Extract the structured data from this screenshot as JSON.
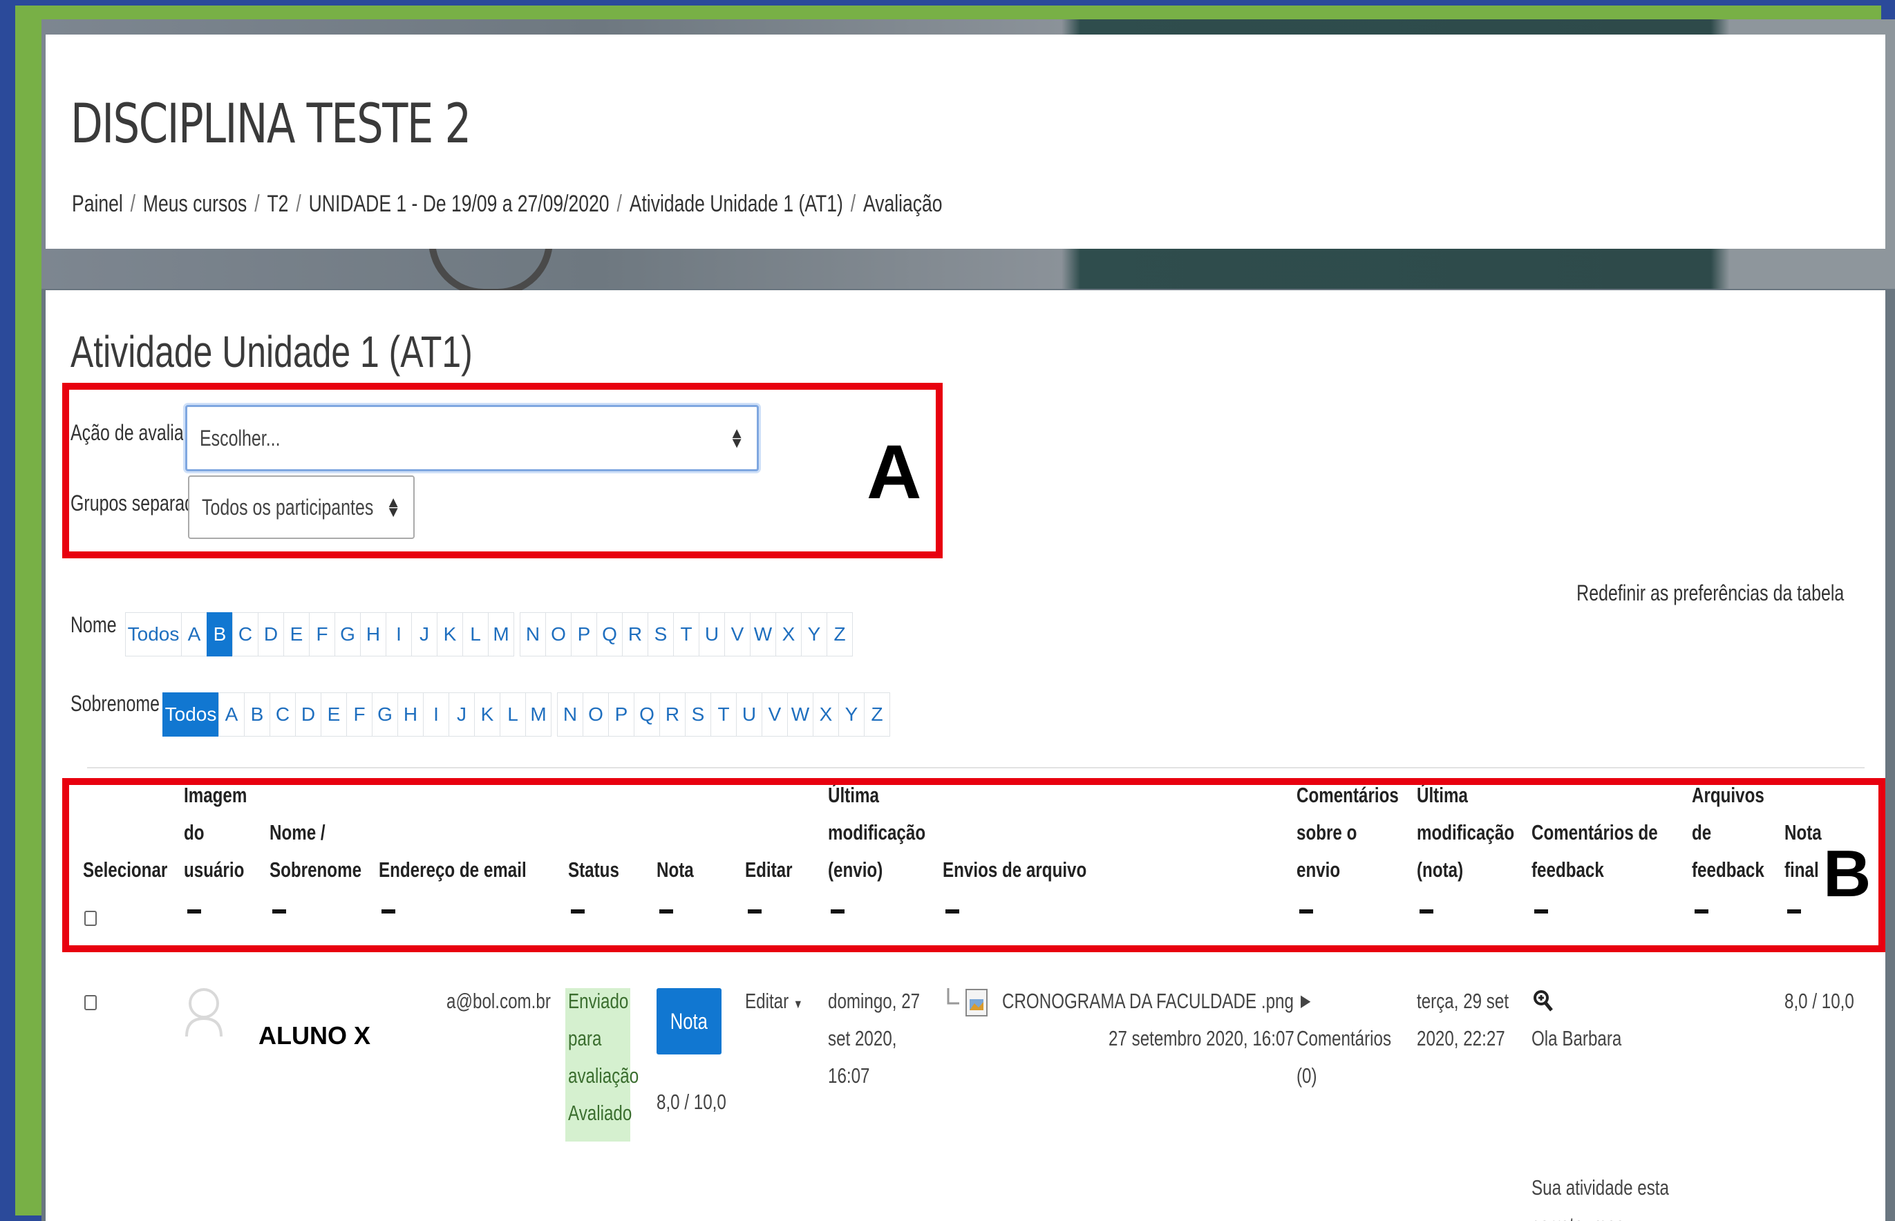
{
  "course": {
    "title": "DISCIPLINA TESTE 2",
    "breadcrumb": [
      "Painel",
      "Meus cursos",
      "T2",
      "UNIDADE 1 - De 19/09 a 27/09/2020",
      "Atividade Unidade 1 (AT1)",
      "Avaliação"
    ]
  },
  "activity": {
    "title": "Atividade Unidade 1 (AT1)",
    "grading_action_label": "Ação de avaliação",
    "grading_action_value": "Escolher...",
    "groups_label": "Grupos separados",
    "groups_value": "Todos os participantes"
  },
  "annotations": {
    "box_a": "A",
    "box_b": "B"
  },
  "reset_prefs": "Redefinir as preferências da tabela",
  "filters": {
    "first_name_label": "Nome",
    "last_name_label": "Sobrenome",
    "all_label": "Todos",
    "letters": [
      "A",
      "B",
      "C",
      "D",
      "E",
      "F",
      "G",
      "H",
      "I",
      "J",
      "K",
      "L",
      "M",
      "N",
      "O",
      "P",
      "Q",
      "R",
      "S",
      "T",
      "U",
      "V",
      "W",
      "X",
      "Y",
      "Z"
    ],
    "first_name_selected": "B",
    "last_name_selected": "Todos"
  },
  "table": {
    "headers": {
      "select": [
        "Selecionar"
      ],
      "image": [
        "Imagem",
        "do",
        "usuário"
      ],
      "name": [
        "Nome /",
        "Sobrenome"
      ],
      "email": [
        "Endereço de email"
      ],
      "status": [
        "Status"
      ],
      "grade": [
        "Nota"
      ],
      "edit": [
        "Editar"
      ],
      "last_mod_sub": [
        "Última",
        "modificação",
        "(envio)"
      ],
      "files": [
        "Envios de arquivo"
      ],
      "sub_comments": [
        "Comentários",
        "sobre o",
        "envio"
      ],
      "last_mod_grade": [
        "Última",
        "modificação",
        "(nota)"
      ],
      "feedback_comments": [
        "Comentários de",
        "feedback"
      ],
      "feedback_files": [
        "Arquivos",
        "de",
        "feedback"
      ],
      "final_grade": [
        "Nota",
        "final"
      ]
    },
    "row": {
      "student": "ALUNO X",
      "email": "a@bol.com.br",
      "status": [
        "Enviado",
        "para",
        "avaliação",
        "Avaliado"
      ],
      "grade_button": "Nota",
      "grade": "8,0 / 10,0",
      "edit": "Editar",
      "last_mod_sub": [
        "domingo, 27",
        "set 2020,",
        "16:07"
      ],
      "file_name": "CRONOGRAMA DA FACULDADE .png",
      "file_date": "27 setembro 2020, 16:07",
      "comments": [
        "Comentários",
        "(0)"
      ],
      "last_mod_grade": [
        "terça, 29 set",
        "2020, 22:27"
      ],
      "feedback": [
        "Ola Barbara",
        "",
        "",
        "",
        "Sua atividade esta",
        "correta, mas"
      ],
      "final_grade": "8,0 / 10,0"
    }
  },
  "colors": {
    "accent": "#1177d1",
    "annotation": "#e8000f",
    "status_bg": "#d5f0cf"
  }
}
